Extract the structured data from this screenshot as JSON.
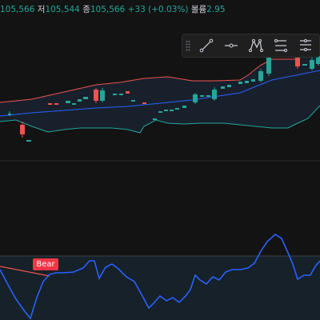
{
  "legend": {
    "open_value": "105,566",
    "low_label": "저",
    "low_value": "105,544",
    "close_label": "종",
    "close_value": "105,566",
    "change": "+33 (+0.03%)",
    "volume_label": "볼륨",
    "volume_value": "2.95"
  },
  "toolbar": {
    "tools": [
      "trend-line-tool",
      "horizontal-ray-tool",
      "pattern-tool",
      "fib-levels-tool",
      "long-position-tool"
    ]
  },
  "colors": {
    "up": "#26a69a",
    "down": "#ef5350",
    "upper_band": "#ef5350",
    "middle_band": "#2962ff",
    "lower_band": "#26a69a",
    "oscillator": "#2962ff",
    "background": "#131313"
  },
  "oscillator": {
    "signal_label": "Bear"
  }
}
